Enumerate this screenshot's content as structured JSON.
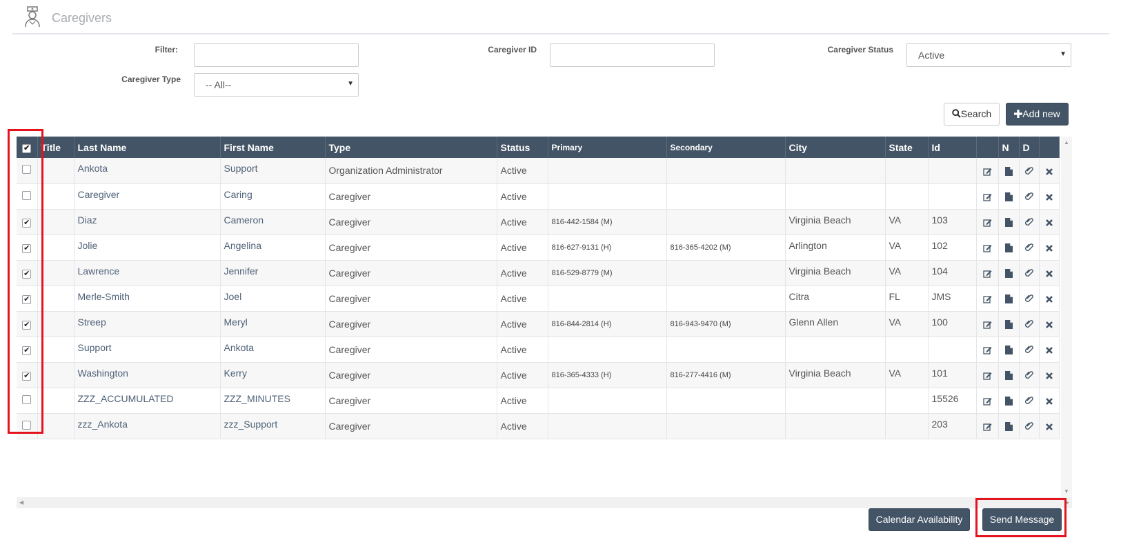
{
  "page": {
    "title": "Caregivers"
  },
  "filters": {
    "filter_label": "Filter:",
    "filter_value": "",
    "caregiver_id_label": "Caregiver ID",
    "caregiver_id_value": "",
    "status_label": "Caregiver Status",
    "status_value": "Active",
    "type_label": "Caregiver Type",
    "type_value": "-- All--"
  },
  "toolbar": {
    "search_label": "Search",
    "add_new_label": "Add new"
  },
  "table": {
    "headers": {
      "title": "Title",
      "last_name": "Last Name",
      "first_name": "First Name",
      "type": "Type",
      "status": "Status",
      "primary": "Primary",
      "secondary": "Secondary",
      "city": "City",
      "state": "State",
      "id": "Id",
      "n": "N",
      "d": "D"
    },
    "header_checked": true,
    "rows": [
      {
        "checked": false,
        "title": "",
        "last": "Ankota",
        "first": "Support",
        "type": "Organization Administrator",
        "status": "Active",
        "primary": "",
        "secondary": "",
        "city": "",
        "state": "",
        "id": ""
      },
      {
        "checked": false,
        "title": "",
        "last": "Caregiver",
        "first": "Caring",
        "type": "Caregiver",
        "status": "Active",
        "primary": "",
        "secondary": "",
        "city": "",
        "state": "",
        "id": ""
      },
      {
        "checked": true,
        "title": "",
        "last": "Diaz",
        "first": "Cameron",
        "type": "Caregiver",
        "status": "Active",
        "primary": "816-442-1584 (M)",
        "secondary": "",
        "city": "Virginia Beach",
        "state": "VA",
        "id": "103"
      },
      {
        "checked": true,
        "title": "",
        "last": "Jolie",
        "first": "Angelina",
        "type": "Caregiver",
        "status": "Active",
        "primary": "816-627-9131 (H)",
        "secondary": "816-365-4202 (M)",
        "city": "Arlington",
        "state": "VA",
        "id": "102"
      },
      {
        "checked": true,
        "title": "",
        "last": "Lawrence",
        "first": "Jennifer",
        "type": "Caregiver",
        "status": "Active",
        "primary": "816-529-8779 (M)",
        "secondary": "",
        "city": "Virginia Beach",
        "state": "VA",
        "id": "104"
      },
      {
        "checked": true,
        "title": "",
        "last": "Merle-Smith",
        "first": "Joel",
        "type": "Caregiver",
        "status": "Active",
        "primary": "",
        "secondary": "",
        "city": "Citra",
        "state": "FL",
        "id": "JMS"
      },
      {
        "checked": true,
        "title": "",
        "last": "Streep",
        "first": "Meryl",
        "type": "Caregiver",
        "status": "Active",
        "primary": "816-844-2814 (H)",
        "secondary": "816-943-9470 (M)",
        "city": "Glenn Allen",
        "state": "VA",
        "id": "100"
      },
      {
        "checked": true,
        "title": "",
        "last": "Support",
        "first": "Ankota",
        "type": "Caregiver",
        "status": "Active",
        "primary": "",
        "secondary": "",
        "city": "",
        "state": "",
        "id": ""
      },
      {
        "checked": true,
        "title": "",
        "last": "Washington",
        "first": "Kerry",
        "type": "Caregiver",
        "status": "Active",
        "primary": "816-365-4333 (H)",
        "secondary": "816-277-4416 (M)",
        "city": "Virginia Beach",
        "state": "VA",
        "id": "101"
      },
      {
        "checked": false,
        "title": "",
        "last": "ZZZ_ACCUMULATED",
        "first": "ZZZ_MINUTES",
        "type": "Caregiver",
        "status": "Active",
        "primary": "",
        "secondary": "",
        "city": "",
        "state": "",
        "id": "15526"
      },
      {
        "checked": false,
        "title": "",
        "last": "zzz_Ankota",
        "first": "zzz_Support",
        "type": "Caregiver",
        "status": "Active",
        "primary": "",
        "secondary": "",
        "city": "",
        "state": "",
        "id": "203"
      }
    ]
  },
  "footer": {
    "calendar_label": "Calendar Availability",
    "send_message_label": "Send Message"
  },
  "icons": {
    "header_logo": "caregiver-nurse-icon",
    "row_actions": [
      "edit-icon",
      "note-icon",
      "paperclip-icon",
      "delete-icon"
    ],
    "search": "search-icon",
    "add": "plus-icon"
  },
  "colors": {
    "header_bg": "#435466",
    "highlight": "#e5131d",
    "button_dark": "#435466"
  }
}
